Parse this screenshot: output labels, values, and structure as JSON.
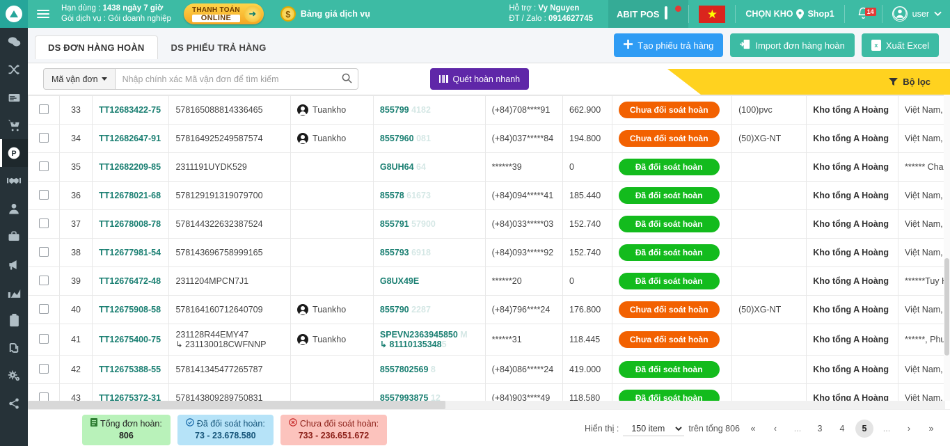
{
  "topbar": {
    "license_label": "Hạn dùng :",
    "license_value": "1438 ngày 7 giờ",
    "package_label": "Gói dịch vụ :",
    "package_value": "Gói doanh nghiệp",
    "pay_line1": "THANH TOÁN",
    "pay_line2": "ONLINE",
    "price_list": "Bảng giá dịch vụ",
    "support_label": "Hỗ trợ :",
    "support_name": "Vy Nguyen",
    "phone_label": "ĐT / Zalo :",
    "phone_value": "0914627745",
    "pos_label": "ABIT POS",
    "warehouse_label": "CHỌN KHO",
    "warehouse_value": "Shop1",
    "notif_count": "14",
    "user_label": "user",
    "brand_color": "#3dbba4"
  },
  "tabs": [
    {
      "label": "DS ĐƠN HÀNG HOÀN",
      "active": true
    },
    {
      "label": "DS PHIẾU TRẢ HÀNG",
      "active": false
    }
  ],
  "actions": {
    "create_return": "Tạo phiếu trả hàng",
    "import_return": "Import đơn hàng hoàn",
    "export_excel": "Xuất Excel"
  },
  "filterbar": {
    "dropdown_label": "Mã vận đơn",
    "search_placeholder": "Nhập chính xác Mã vận đơn để tìm kiếm",
    "search_value": "",
    "scan_button": "Quét hoàn nhanh",
    "filter_button": "Bộ lọc",
    "filter_color": "#ffd21f"
  },
  "table": {
    "rows": [
      {
        "idx": "33",
        "code": "TT12683422-75",
        "tracking": "578165088814336465",
        "staff": "Tuankho",
        "order": "855799",
        "order_fade": "4182",
        "phone": "(+84)708****91",
        "money": "662.900",
        "status": "Chưa đối soát hoàn",
        "status_type": "orange",
        "tag": "(100)pvc",
        "store": "Kho tổng A Hoàng",
        "address": "Việt Nam, Hồ Chí Minh, B"
      },
      {
        "idx": "34",
        "code": "TT12682647-91",
        "tracking": "578164925249587574",
        "staff": "Tuankho",
        "order": "8557960",
        "order_fade": "081",
        "phone": "(+84)037*****84",
        "money": "194.800",
        "status": "Chưa đối soát hoàn",
        "status_type": "orange",
        "tag": "(50)XG-NT",
        "store": "Kho tổng A Hoàng",
        "address": "Việt Nam, Hoà Bình, Kim"
      },
      {
        "idx": "35",
        "code": "TT12682209-85",
        "tracking": "2311191UYDK529",
        "staff": "",
        "order": "G8UH64",
        "order_fade": "64",
        "phone": "******39",
        "money": "0",
        "status": "Đã đối soát hoàn",
        "status_type": "green",
        "tag": "",
        "store": "Kho tổng A Hoàng",
        "address": "****** Chau Thanh Tay Ni"
      },
      {
        "idx": "36",
        "code": "TT12678021-68",
        "tracking": "578129191319079700",
        "staff": "",
        "order": "85578",
        "order_fade": "61673",
        "phone": "(+84)094*****41",
        "money": "185.440",
        "status": "Đã đối soát hoàn",
        "status_type": "green",
        "tag": "",
        "store": "Kho tổng A Hoàng",
        "address": "Việt Nam, Bạc Liêu, Vĩnh"
      },
      {
        "idx": "37",
        "code": "TT12678008-78",
        "tracking": "578144322632387524",
        "staff": "",
        "order": "855791",
        "order_fade": "57900",
        "phone": "(+84)033*****03",
        "money": "152.740",
        "status": "Đã đối soát hoàn",
        "status_type": "green",
        "tag": "",
        "store": "Kho tổng A Hoàng",
        "address": "Việt Nam, Bình Thuận, B"
      },
      {
        "idx": "38",
        "code": "TT12677981-54",
        "tracking": "578143696758999165",
        "staff": "",
        "order": "855793",
        "order_fade": "6918",
        "phone": "(+84)093*****92",
        "money": "152.740",
        "status": "Đã đối soát hoàn",
        "status_type": "green",
        "tag": "",
        "store": "Kho tổng A Hoàng",
        "address": "Việt Nam, Tỉnh Quang Ng"
      },
      {
        "idx": "39",
        "code": "TT12676472-48",
        "tracking": "2311204MPCN7J1",
        "staff": "",
        "order": "G8UX49E",
        "order_fade": "",
        "phone": "******20",
        "money": "0",
        "status": "Đã đối soát hoàn",
        "status_type": "green",
        "tag": "",
        "store": "Kho tổng A Hoàng",
        "address": "******Tuy Hòa Phú Yên, P"
      },
      {
        "idx": "40",
        "code": "TT12675908-58",
        "tracking": "578164160712640709",
        "staff": "Tuankho",
        "order": "855790",
        "order_fade": "2287",
        "phone": "(+84)796****24",
        "money": "176.800",
        "status": "Chưa đối soát hoàn",
        "status_type": "orange",
        "tag": "(50)XG-NT",
        "store": "Kho tổng A Hoàng",
        "address": "Việt Nam, Hồ Chí Minh, T"
      },
      {
        "idx": "41",
        "code": "TT12675400-75",
        "tracking": "231128R44EMY47",
        "tracking_sub": "231130018CWFNNP",
        "staff": "Tuankho",
        "order": "SPEVN2363945850",
        "order_fade": "M",
        "order_sub": "81110135348",
        "order_sub_fade": "5",
        "phone": "******31",
        "money": "118.445",
        "status": "Chưa đối soát hoàn",
        "status_type": "orange",
        "tag": "",
        "store": "Kho tổng A Hoàng",
        "address": "******, Phường Cẩm Trun"
      },
      {
        "idx": "42",
        "code": "TT12675388-55",
        "tracking": "578141345477265787",
        "staff": "",
        "order": "8557802569",
        "order_fade": "8",
        "phone": "(+84)086*****24",
        "money": "419.000",
        "status": "Đã đối soát hoàn",
        "status_type": "green",
        "tag": "",
        "store": "Kho tổng A Hoàng",
        "address": "Việt Nam, Thái Nguyên, S"
      },
      {
        "idx": "43",
        "code": "TT12675372-31",
        "tracking": "578143809289750831",
        "staff": "",
        "order": "8557993875",
        "order_fade": "12",
        "phone": "(+84)903****49",
        "money": "118.580",
        "status": "Đã đối soát hoàn",
        "status_type": "green",
        "tag": "",
        "store": "Kho tổng A Hoàng",
        "address": "Việt Nam, Hồ Chí Minh, C"
      }
    ]
  },
  "summary": {
    "total_label": "Tổng đơn hoàn:",
    "total_value": "806",
    "done_label": "Đã đối soát hoàn:",
    "done_value": "73 - 23.678.580",
    "pending_label": "Chưa đối soát hoàn:",
    "pending_value": "733 - 236.651.672"
  },
  "pagination": {
    "show_label": "Hiển thị :",
    "page_size": "150 item",
    "total_label": "trên tổng 806",
    "first": "«",
    "prev": "‹",
    "ellipsis_left": "...",
    "pages": [
      "3",
      "4",
      "5"
    ],
    "current_page": "5",
    "ellipsis_right": "...",
    "next": "›",
    "last": "»"
  },
  "sidebar": {
    "items": [
      {
        "name": "chat-icon"
      },
      {
        "name": "shuffle-icon"
      },
      {
        "name": "card-icon"
      },
      {
        "name": "cart-icon"
      },
      {
        "name": "parking-icon"
      },
      {
        "name": "handshake-icon"
      },
      {
        "name": "user-icon"
      },
      {
        "name": "briefcase-icon"
      },
      {
        "name": "megaphone-icon"
      },
      {
        "name": "chart-icon"
      },
      {
        "name": "clipboard-icon"
      },
      {
        "name": "shekel-icon"
      },
      {
        "name": "gears-icon"
      },
      {
        "name": "share-icon"
      }
    ]
  }
}
